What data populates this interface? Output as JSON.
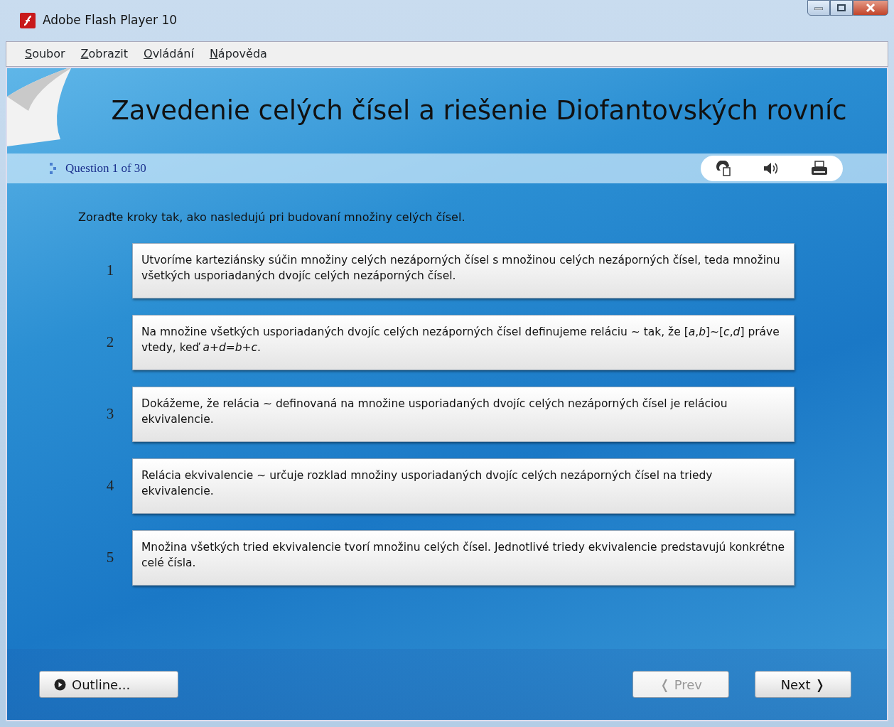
{
  "window": {
    "title": "Adobe Flash Player 10"
  },
  "menu": [
    {
      "label": "Soubor"
    },
    {
      "label": "Zobrazit"
    },
    {
      "label": "Ovládání"
    },
    {
      "label": "Nápověda"
    }
  ],
  "heading": "Zavedenie celých čísel a riešenie Diofantovských rovníc",
  "question_counter": "Question 1 of 30",
  "instruction": "Zoraďte kroky tak, ako nasledujú pri budovaní množiny celých čísel.",
  "steps": [
    {
      "number": "1",
      "text": "Utvoríme karteziánsky súčin množiny celých nezáporných čísel s množinou celých nezáporných čísel, teda množinu všetkých usporiadaných dvojíc celých nezáporných čísel."
    },
    {
      "number": "2",
      "text": "Na množine všetkých usporiadaných dvojíc celých nezáporných čísel definujeme reláciu ~ tak, že [*a*,*b*]~[*c*,*d*] práve vtedy, keď *a*+*d*=*b*+*c*."
    },
    {
      "number": "3",
      "text": "Dokážeme, že relácia ~ definovaná na množine usporiadaných dvojíc celých nezáporných čísel je reláciou ekvivalencie."
    },
    {
      "number": "4",
      "text": "Relácia ekvivalencie ~ určuje rozklad množiny usporiadaných dvojíc celých nezáporných čísel na triedy ekvivalencie."
    },
    {
      "number": "5",
      "text": "Množina všetkých tried ekvivalencie tvorí množinu celých čísel. Jednotlivé triedy ekvivalencie predstavujú konkrétne celé čísla."
    }
  ],
  "buttons": {
    "outline": {
      "label": "Outline...",
      "disabled": false
    },
    "prev": {
      "label": "❬ Prev",
      "disabled": true
    },
    "next": {
      "label": "Next ❭",
      "disabled": false
    }
  }
}
